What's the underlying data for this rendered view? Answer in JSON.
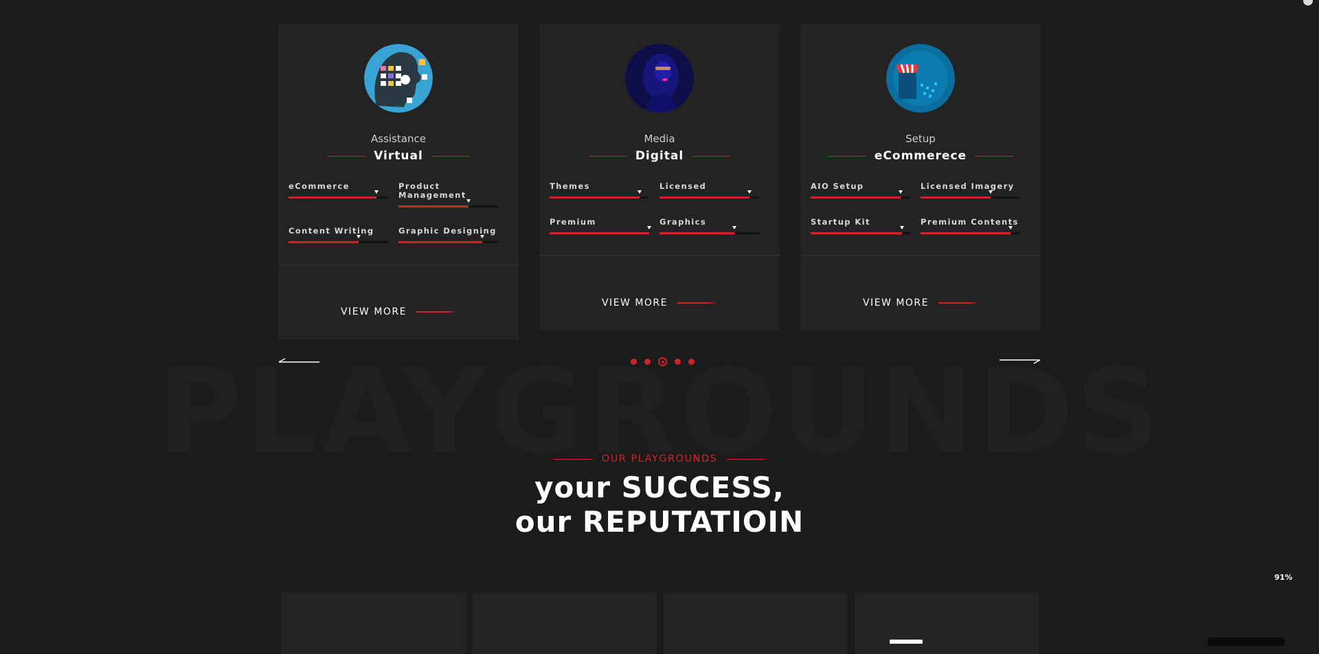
{
  "cards": [
    {
      "category": "Assistance",
      "title": "Virtual",
      "avatar_icon": "virtual-assistant-icon",
      "skills": [
        {
          "label": "eCommerce",
          "percent": 88
        },
        {
          "label": "Product Management",
          "percent": 70
        },
        {
          "label": "Content Writing",
          "percent": 70
        },
        {
          "label": "Graphic Designing",
          "percent": 84
        }
      ],
      "view_more": "VIEW MORE"
    },
    {
      "category": "Media",
      "title": "Digital",
      "avatar_icon": "digital-media-icon",
      "skills": [
        {
          "label": "Themes",
          "percent": 90
        },
        {
          "label": "Licensed",
          "percent": 90
        },
        {
          "label": "Premium",
          "percent": 100
        },
        {
          "label": "Graphics",
          "percent": 75
        }
      ],
      "view_more": "VIEW MORE"
    },
    {
      "category": "Setup",
      "title": "eCommerece",
      "avatar_icon": "ecommerce-setup-icon",
      "skills": [
        {
          "label": "AIO Setup",
          "percent": 90
        },
        {
          "label": "Licensed Imagery",
          "percent": 70
        },
        {
          "label": "Startup Kit",
          "percent": 92
        },
        {
          "label": "Premium Contents",
          "percent": 90
        }
      ],
      "view_more": "VIEW MORE"
    }
  ],
  "carousel": {
    "dot_count": 5,
    "active_index": 2
  },
  "section": {
    "background_word": "PLAYGROUNDS",
    "kicker": "OUR PLAYGROUNDS",
    "headline_line1": "your SUCCESS,",
    "headline_line2": "our REPUTATIOIN"
  },
  "zoom_label": "91%",
  "colors": {
    "accent": "#d0242b",
    "background": "#1b1b1b",
    "card": "#232323"
  }
}
